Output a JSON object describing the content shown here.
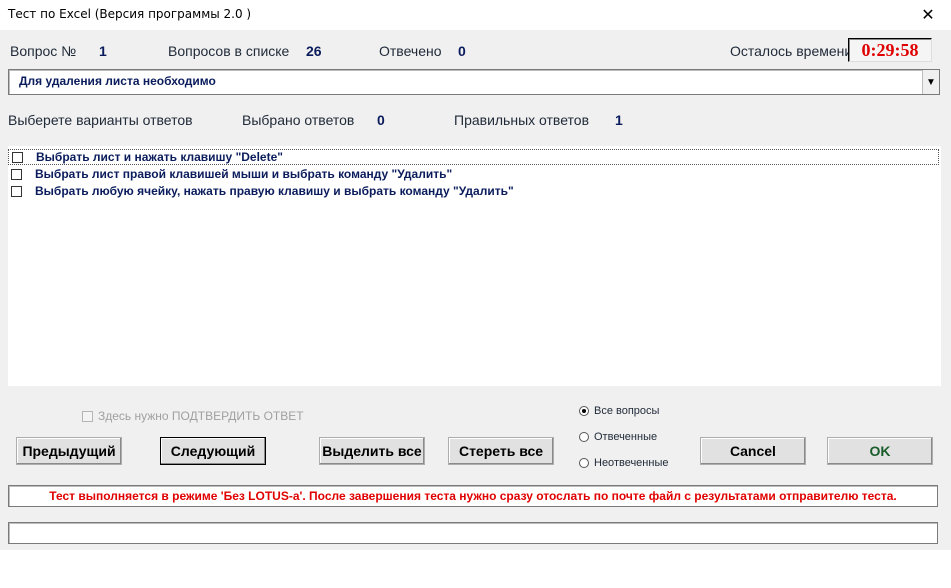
{
  "window": {
    "title": "Тест по Excel (Версия программы 2.0 )",
    "close_glyph": "✕"
  },
  "header": {
    "question_label": "Вопрос №",
    "question_value": "1",
    "count_label": "Вопросов в списке",
    "count_value": "26",
    "answered_label": "Отвечено",
    "answered_value": "0",
    "time_label": "Осталось времени",
    "time_value": "0:29:58"
  },
  "question": {
    "text": "Для удаления листа необходимо",
    "dropdown_glyph": "▼"
  },
  "answers_header": {
    "choose_label": "Выберете варианты ответов",
    "selected_label": "Выбрано ответов",
    "selected_value": "0",
    "correct_label": "Правильных ответов",
    "correct_value": "1"
  },
  "answers": [
    {
      "text": "Выбрать лист и нажать клавишу \"Delete\""
    },
    {
      "text": "Выбрать лист правой клавишей мыши и выбрать команду \"Удалить\""
    },
    {
      "text": "Выбрать любую ячейку, нажать правую клавишу и выбрать команду \"Удалить\""
    }
  ],
  "confirm": {
    "label": "Здесь нужно ПОДТВЕРДИТЬ ОТВЕТ"
  },
  "buttons": {
    "prev": "Предыдущий",
    "next": "Следующий",
    "select_all": "Выделить все",
    "clear_all": "Стереть все",
    "cancel": "Cancel",
    "ok": "OK"
  },
  "filters": {
    "all": "Все вопросы",
    "answered": "Отвеченные",
    "unanswered": "Неотвеченные",
    "selected": "all"
  },
  "status": {
    "message": "Тест выполняется в режиме 'Без LOTUS-а'. После завершения теста нужно сразу отослать по почте файл с результатами отправителю теста.",
    "message_color": "#e00000"
  },
  "colors": {
    "value_text": "#0b1c5c",
    "timer": "#e00000",
    "ok_text": "#1a5c2a"
  }
}
